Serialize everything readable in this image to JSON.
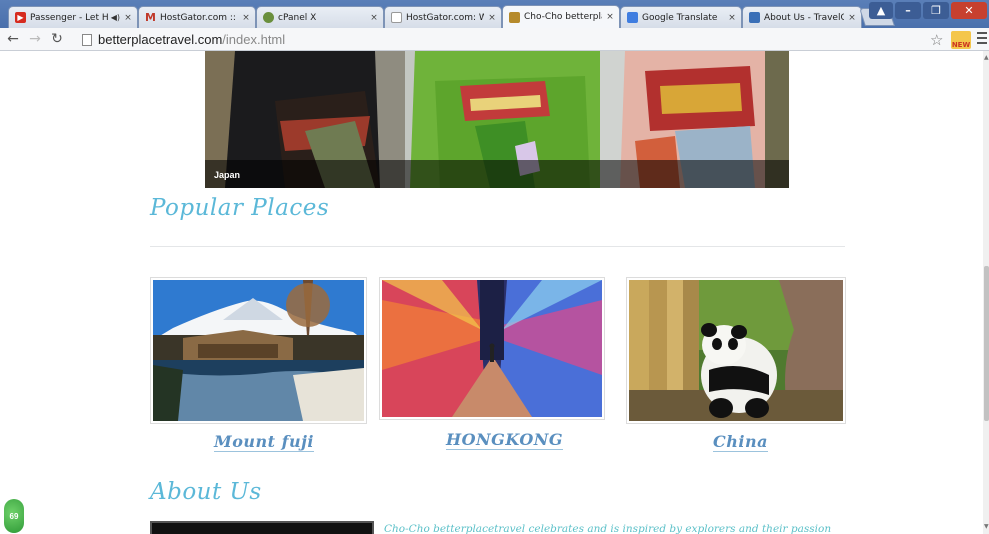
{
  "browser": {
    "tabs": [
      {
        "title": "Passenger - Let H",
        "favicon_color": "#d62b1f",
        "has_audio": true
      },
      {
        "title": "HostGator.com :: You",
        "favicon_color": "#c0392b",
        "favicon_letter": "M"
      },
      {
        "title": "cPanel X",
        "favicon_color": "#6a8f3d"
      },
      {
        "title": "HostGator.com: We a",
        "favicon_color": "#9aa5b5"
      },
      {
        "title": "Cho-Cho betterplace",
        "favicon_color": "#b58a2c",
        "active": true
      },
      {
        "title": "Google Translate",
        "favicon_color": "#3f7de0"
      },
      {
        "title": "About Us - TravelCha",
        "favicon_color": "#3a6fb7"
      }
    ],
    "close_glyph": "×",
    "url_host": "betterplacetravel.com",
    "url_path": "/index.html",
    "extension_label": "NEW"
  },
  "page": {
    "hero": {
      "caption": "Japan"
    },
    "popular": {
      "title": "Popular Places",
      "cards": [
        {
          "label": "Mount fuji"
        },
        {
          "label": "HONGKONG"
        },
        {
          "label": "China"
        }
      ]
    },
    "about": {
      "title": "About Us",
      "text": "Cho-Cho betterplacetravel celebrates and is inspired by explorers and their passion"
    }
  },
  "widget": {
    "badge_text": "69"
  },
  "colors": {
    "section_title": "#5bb8d8",
    "card_label": "#5a8fbf",
    "about_text": "#5bc0c8",
    "tabbar": "#4a70ac"
  }
}
